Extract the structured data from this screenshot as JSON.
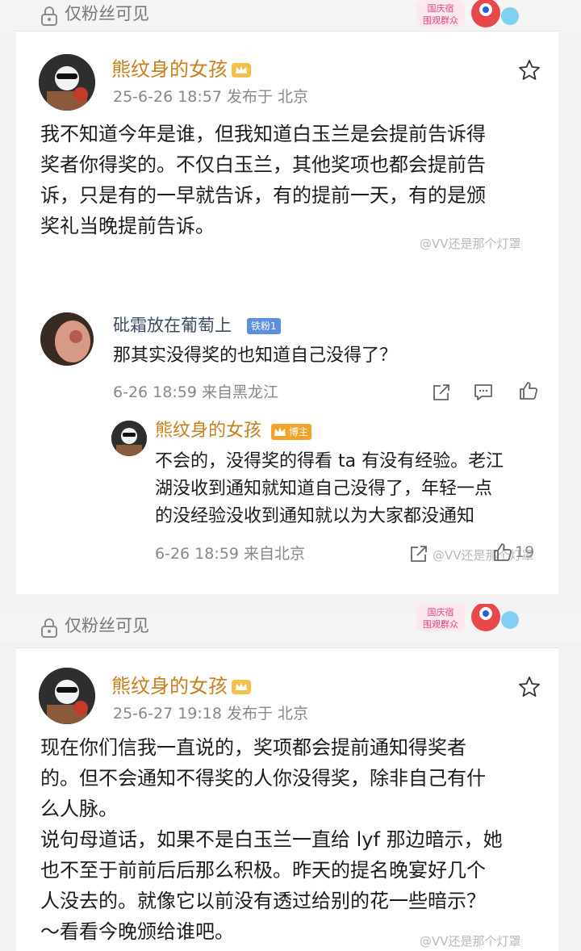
{
  "privacy_label": "仅粉丝可见",
  "sticker_text": "国庆宿\n围观群众",
  "posts": [
    {
      "author": "熊纹身的女孩",
      "meta": "25-6-26 18:57  发布于 北京",
      "lines": [
        "我不知道今年是谁，但我知道白玉兰是会提前告诉得",
        "奖者你得奖的。不仅白玉兰，其他奖项也都会提前告",
        "诉，只是有的一早就告诉，有的提前一天，有的是颁",
        "奖礼当晚提前告诉。"
      ]
    },
    {
      "author": "熊纹身的女孩",
      "meta": "25-6-27 19:18  发布于 北京",
      "lines": [
        "现在你们信我一直说的，奖项都会提前通知得奖者",
        "的。但不会通知不得奖的人你没得奖，除非自己有什",
        "么人脉。",
        "说句母道话，如果不是白玉兰一直给 lyf 那边暗示，她",
        "也不至于前前后后那么积极。昨天的提名晚宴好几个",
        "人没去的。就像它以前没有透过给别的花一些暗示？",
        "～看看今晚颁给谁吧。"
      ]
    }
  ],
  "comment": {
    "author": "砒霜放在葡萄上",
    "badge": "铁粉1",
    "text": "那其实没得奖的也知道自己没得了？",
    "meta": "6-26 18:59  来自黑龙江"
  },
  "reply": {
    "author": "熊纹身的女孩",
    "badge": "博主",
    "lines": [
      "不会的，没得奖的得看 ta 有没有经验。老江",
      "湖没收到通知就知道自己没得了，年轻一点",
      "的没经验没收到通知就以为大家都没通知"
    ],
    "meta": "6-26 18:59  来自北京",
    "likes": "19"
  },
  "watermark": "@VV还是那个灯罩",
  "colors": {
    "username": "#c7801d",
    "meta_gray": "#888888",
    "badge_fan": "#5b8fe0",
    "badge_host": "#f3a32b"
  },
  "icons": [
    "lock-icon",
    "star-icon",
    "crown-icon",
    "share-icon",
    "comment-icon",
    "like-icon"
  ]
}
